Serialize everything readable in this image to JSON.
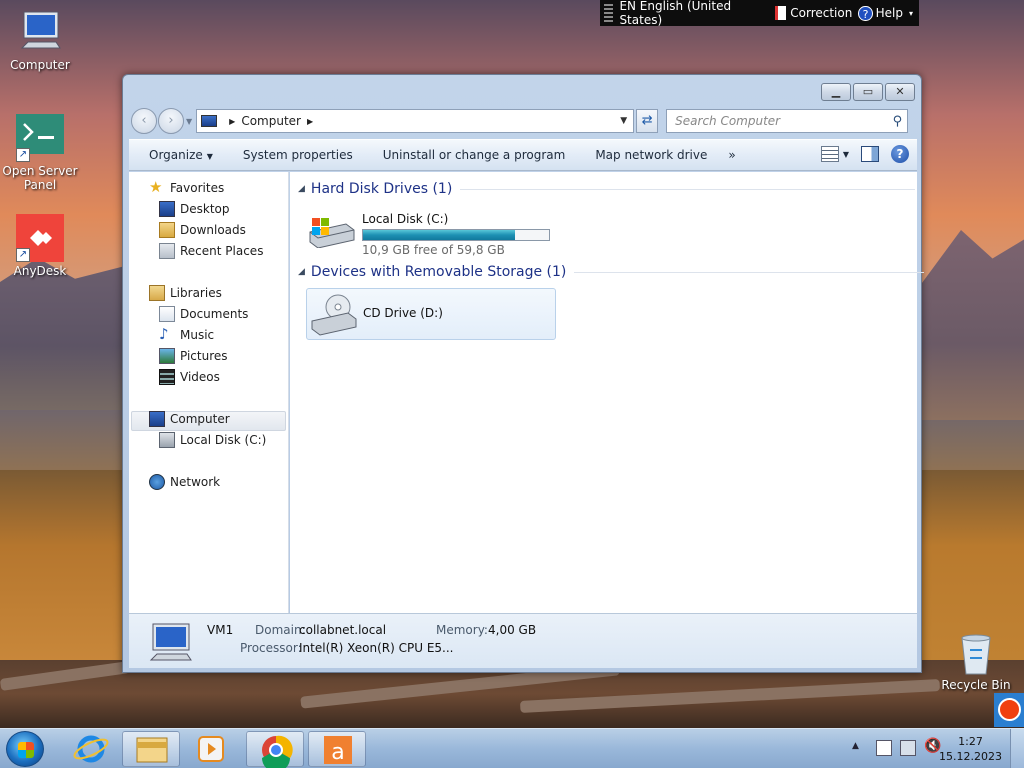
{
  "desktop": {
    "icons": [
      {
        "label": "Computer"
      },
      {
        "label": "Open Server Panel"
      },
      {
        "label": "AnyDesk"
      },
      {
        "label": "Recycle Bin"
      }
    ]
  },
  "langbar": {
    "language": "EN English (United States)",
    "correction": "Correction",
    "help": "Help"
  },
  "window": {
    "address": {
      "location": "Computer"
    },
    "search": {
      "placeholder": "Search Computer"
    },
    "toolbar": {
      "organize": "Organize",
      "system_properties": "System properties",
      "uninstall": "Uninstall or change a program",
      "map_drive": "Map network drive",
      "more": "»"
    },
    "nav": {
      "favorites": "Favorites",
      "desktop": "Desktop",
      "downloads": "Downloads",
      "recent": "Recent Places",
      "libraries": "Libraries",
      "documents": "Documents",
      "music": "Music",
      "pictures": "Pictures",
      "videos": "Videos",
      "computer": "Computer",
      "local_disk": "Local Disk (C:)",
      "network": "Network"
    },
    "groups": {
      "hdd": "Hard Disk Drives (1)",
      "removable": "Devices with Removable Storage (1)"
    },
    "drives": {
      "c_name": "Local Disk (C:)",
      "c_free": "10,9 GB free of 59,8 GB",
      "c_used_fraction": 0.818,
      "d_name": "CD Drive (D:)"
    },
    "details": {
      "name": "VM1",
      "domain_label": "Domain:",
      "domain_value": "collabnet.local",
      "memory_label": "Memory:",
      "memory_value": "4,00 GB",
      "processor_label": "Processor:",
      "processor_value": "Intel(R) Xeon(R) CPU E5..."
    }
  },
  "taskbar": {
    "time": "1:27",
    "date": "15.12.2023"
  },
  "colors": {
    "group_header": "#1e3287",
    "drive_fill": "#1d90b3"
  }
}
